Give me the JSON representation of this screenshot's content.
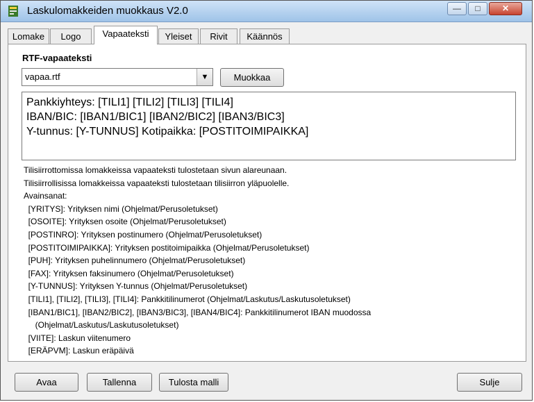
{
  "window": {
    "title": "Laskulomakkeiden muokkaus V2.0",
    "controls": {
      "minimize": "—",
      "maximize": "□",
      "close": "✕"
    }
  },
  "tabs": [
    {
      "label": "Lomake"
    },
    {
      "label": "Logo"
    },
    {
      "label": "Vapaateksti",
      "active": true
    },
    {
      "label": "Yleiset"
    },
    {
      "label": "Rivit"
    },
    {
      "label": "Käännös"
    }
  ],
  "rtf": {
    "label": "RTF-vapaateksti",
    "file_select": "vapaa.rtf",
    "edit_button": "Muokkaa",
    "text_lines": [
      "Pankkiyhteys: [TILI1] [TILI2] [TILI3] [TILI4]",
      "IBAN/BIC: [IBAN1/BIC1] [IBAN2/BIC2] [IBAN3/BIC3]",
      "Y-tunnus: [Y-TUNNUS]  Kotipaikka: [POSTITOIMIPAIKKA]"
    ]
  },
  "info_lines": [
    "Tilisiirrottomissa lomakkeissa vapaateksti tulostetaan sivun alareunaan.",
    "Tilisiirrollisissa lomakkeissa vapaateksti tulostetaan tilisiirron yläpuolelle.",
    "Avainsanat:",
    "  [YRITYS]: Yrityksen nimi (Ohjelmat/Perusoletukset)",
    "  [OSOITE]: Yrityksen osoite (Ohjelmat/Perusoletukset)",
    "  [POSTINRO]: Yrityksen postinumero (Ohjelmat/Perusoletukset)",
    "  [POSTITOIMIPAIKKA]: Yrityksen postitoimipaikka (Ohjelmat/Perusoletukset)",
    "  [PUH]: Yrityksen puhelinnumero (Ohjelmat/Perusoletukset)",
    "  [FAX]: Yrityksen faksinumero (Ohjelmat/Perusoletukset)",
    "  [Y-TUNNUS]: Yrityksen Y-tunnus (Ohjelmat/Perusoletukset)",
    "  [TILI1], [TILI2], [TILI3], [TILI4]: Pankkitilinumerot (Ohjelmat/Laskutus/Laskutusoletukset)",
    "  [IBAN1/BIC1], [IBAN2/BIC2], [IBAN3/BIC3], [IBAN4/BIC4]: Pankkitilinumerot IBAN muodossa",
    "     (Ohjelmat/Laskutus/Laskutusoletukset)",
    "  [VIITE]: Laskun viitenumero",
    "  [ERÄPVM]: Laskun eräpäivä"
  ],
  "buttons": {
    "open": "Avaa",
    "save": "Tallenna",
    "print": "Tulosta malli",
    "close": "Sulje"
  }
}
